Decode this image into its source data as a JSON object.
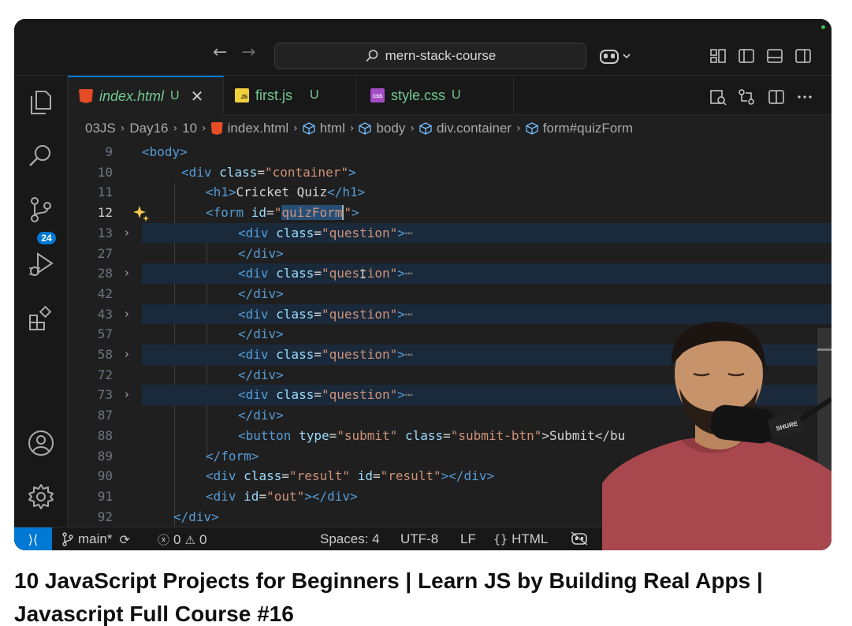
{
  "titlebar": {
    "search_text": "mern-stack-course"
  },
  "activity_bar": {
    "source_control_badge": "24"
  },
  "tabs": [
    {
      "name": "index.html",
      "status": "U",
      "icon": "html-file-icon",
      "active": true
    },
    {
      "name": "first.js",
      "status": "U",
      "icon": "js-file-icon",
      "active": false
    },
    {
      "name": "style.css",
      "status": "U",
      "icon": "css-file-icon",
      "active": false
    }
  ],
  "breadcrumb": {
    "items": [
      "03JS",
      "Day16",
      "10",
      "index.html",
      "html",
      "body",
      "div.container",
      "form#quizForm"
    ]
  },
  "editor": {
    "line_numbers": [
      "9",
      "10",
      "11",
      "12",
      "13",
      "27",
      "28",
      "42",
      "43",
      "57",
      "58",
      "72",
      "73",
      "87",
      "88",
      "89",
      "90",
      "91",
      "92"
    ],
    "code": {
      "l9_tag": "<body>",
      "l10_open": "<div ",
      "l10_attr": "class",
      "l10_eq": "=",
      "l10_val": "\"container\"",
      "l10_close": ">",
      "l11_open": "<h1>",
      "l11_text": "Cricket Quiz",
      "l11_close": "</h1>",
      "l12_open": "<form ",
      "l12_attr": "id",
      "l12_eq": "=",
      "l12_q1": "\"",
      "l12_sel": "quizForm",
      "l12_q2": "\"",
      "l12_close": ">",
      "question_open": "<div ",
      "question_attr": "class",
      "question_eq": "=",
      "question_val": "\"question\"",
      "question_close": ">",
      "question_ellipsis": "⋯",
      "div_close": "</div>",
      "l88_open": "<button ",
      "l88_attr1": "type",
      "l88_val1": "\"submit\"",
      "l88_attr2": "class",
      "l88_val2": "\"submit-btn\"",
      "l88_text": ">Submit</bu",
      "l89_tag": "</form>",
      "l90_open": "<div ",
      "l90_attr1": "class",
      "l90_val1": "\"result\"",
      "l90_attr2": "id",
      "l90_val2": "\"result\"",
      "l90_close": "></div>",
      "l91_open": "<div ",
      "l91_attr": "id",
      "l91_val": "\"out\"",
      "l91_close": "></div>",
      "l92_tag": "</div>"
    }
  },
  "statusbar": {
    "branch": "main*",
    "errors": "0",
    "warnings": "0",
    "spaces": "Spaces: 4",
    "encoding": "UTF-8",
    "eol": "LF",
    "language": "HTML",
    "mic_brand": "SHURE"
  },
  "video": {
    "title": "10 JavaScript Projects for Beginners | Learn JS by Building Real Apps | Javascript Full Course #16"
  },
  "colors": {
    "accent": "#0078d4",
    "untracked": "#73c991",
    "tag": "#569cd6",
    "attribute": "#9cdcfe",
    "string": "#ce9178"
  }
}
